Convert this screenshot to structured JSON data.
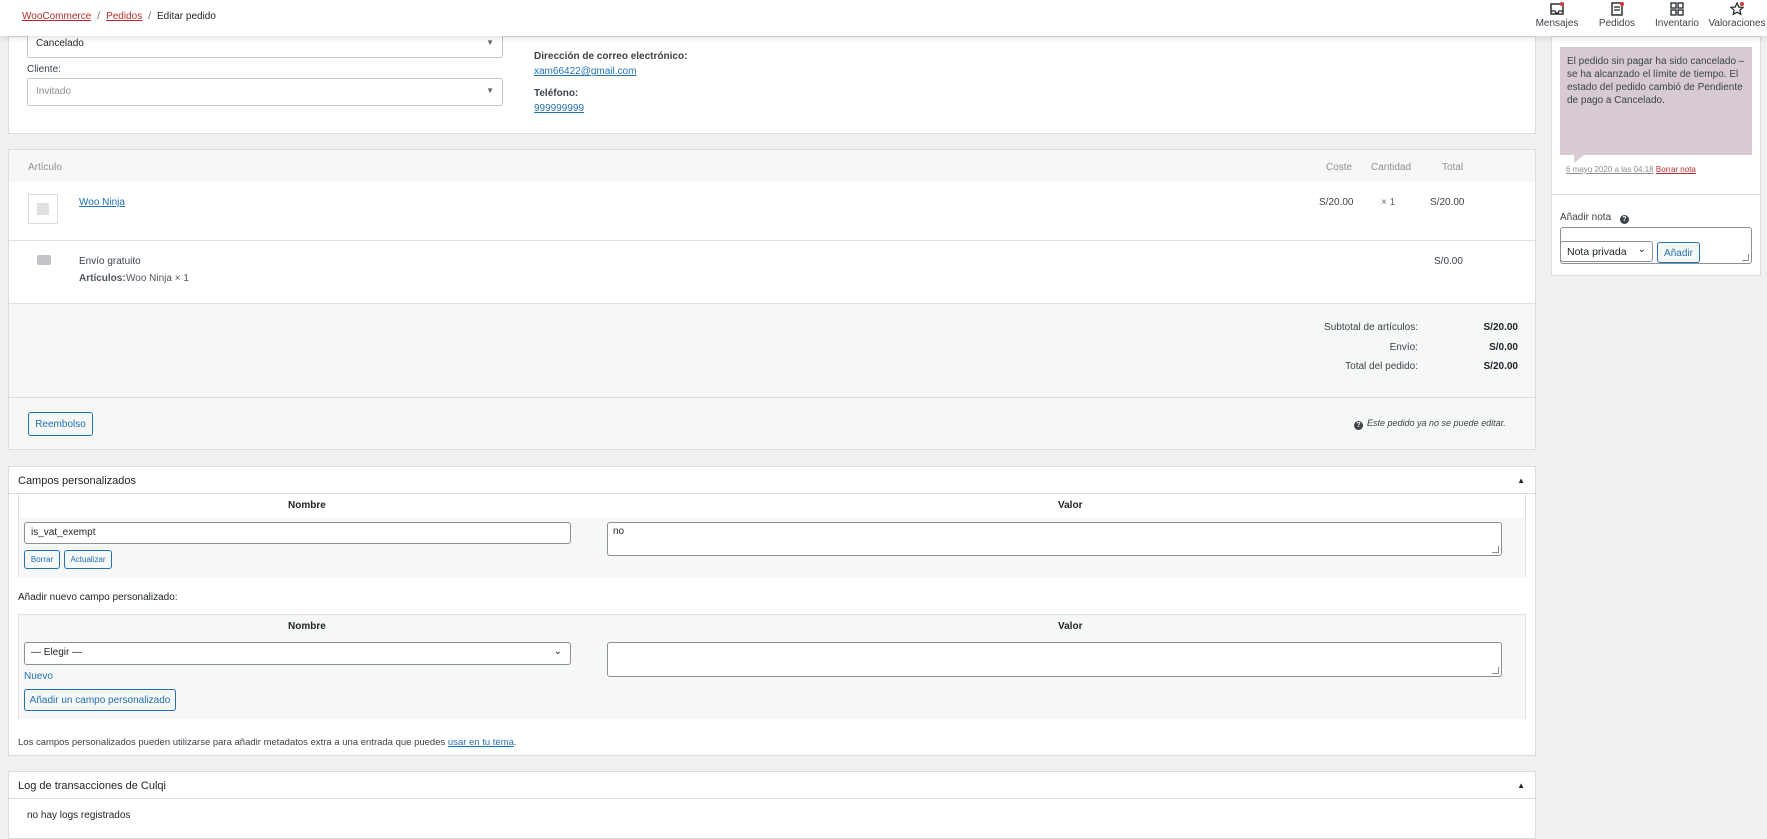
{
  "breadcrumb": {
    "root": "WooCommerce",
    "section": "Pedidos",
    "current": "Editar pedido"
  },
  "activity_bar": [
    {
      "label": "Mensajes",
      "icon": "inbox-icon"
    },
    {
      "label": "Pedidos",
      "icon": "orders-icon"
    },
    {
      "label": "Inventario",
      "icon": "inventory-icon"
    },
    {
      "label": "Valoraciones",
      "icon": "star-icon"
    }
  ],
  "order": {
    "status_value": "Cancelado",
    "customer_label": "Cliente:",
    "customer_value": "Invitado",
    "email_label": "Dirección de correo electrónico:",
    "email_value": "xam66422@gmail.com",
    "phone_label": "Teléfono:",
    "phone_value": "999999999"
  },
  "items_table": {
    "headers": {
      "item": "Artículo",
      "cost": "Coste",
      "qty": "Cantidad",
      "total": "Total"
    },
    "line_item": {
      "name": "Woo Ninja",
      "cost": "S/20.00",
      "qty": "× 1",
      "total": "S/20.00"
    },
    "shipping": {
      "name": "Envío gratuito",
      "meta_label": "Artículos:",
      "meta_value": "Woo Ninja × 1",
      "total": "S/0.00"
    },
    "totals": [
      {
        "label": "Subtotal de artículos:",
        "value": "S/20.00"
      },
      {
        "label": "Envío:",
        "value": "S/0.00"
      },
      {
        "label": "Total del pedido:",
        "value": "S/20.00"
      }
    ],
    "refund_button": "Reembolso",
    "not_editable_note": "Este pedido ya no se puede editar."
  },
  "custom_fields": {
    "title": "Campos personalizados",
    "col_name": "Nombre",
    "col_value": "Valor",
    "existing": {
      "key": "is_vat_exempt",
      "value": "no",
      "delete_label": "Borrar",
      "update_label": "Actualizar"
    },
    "add_title": "Añadir nuevo campo personalizado:",
    "choose_placeholder": "— Elegir —",
    "new_link": "Nuevo",
    "add_button": "Añadir un campo personalizado",
    "footer_text": "Los campos personalizados pueden utilizarse para añadir metadatos extra a una entrada que puedes",
    "footer_link": "usar en tu tema"
  },
  "culqi": {
    "title": "Log de transacciones de Culqi",
    "empty_text": "no hay logs registrados"
  },
  "notes": {
    "note_text": "El pedido sin pagar ha sido cancelado – se ha alcanzado el límite de tiempo. El estado del pedido cambió de Pendiente de pago a Cancelado.",
    "note_date": "6 mayo 2020 a las 04:18",
    "delete_link": "Borrar nota",
    "add_note_label": "Añadir nota",
    "note_type": "Nota privada",
    "add_button": "Añadir"
  }
}
